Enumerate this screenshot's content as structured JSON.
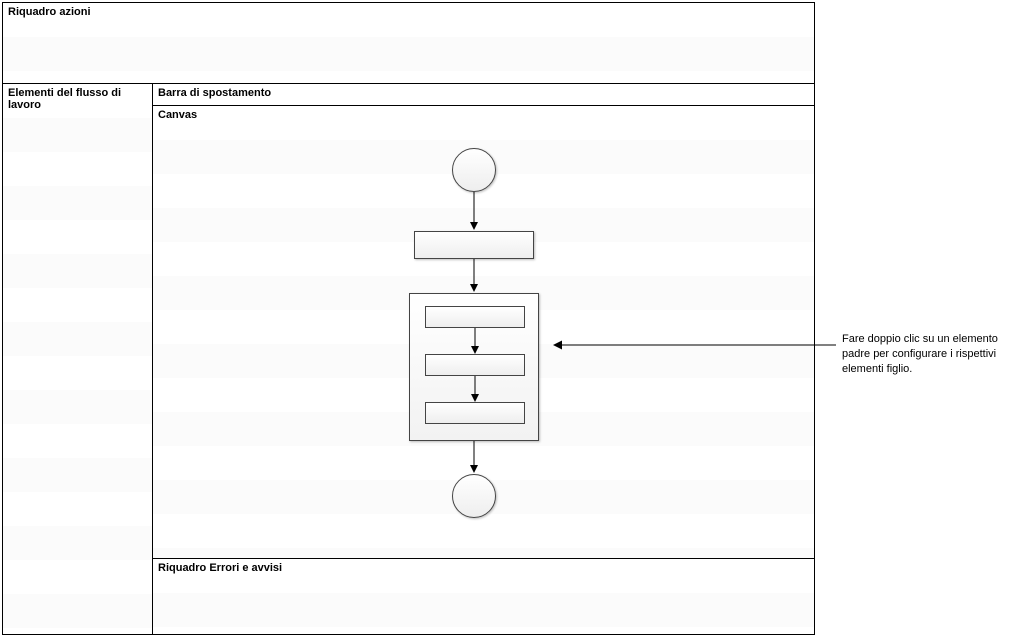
{
  "panes": {
    "actions": "Riquadro azioni",
    "elements": "Elementi del flusso di lavoro",
    "navbar": "Barra di spostamento",
    "canvas": "Canvas",
    "errors": "Riquadro Errori e avvisi"
  },
  "annotation": "Fare doppio clic su un elemento padre per configurare i rispettivi elementi figlio."
}
